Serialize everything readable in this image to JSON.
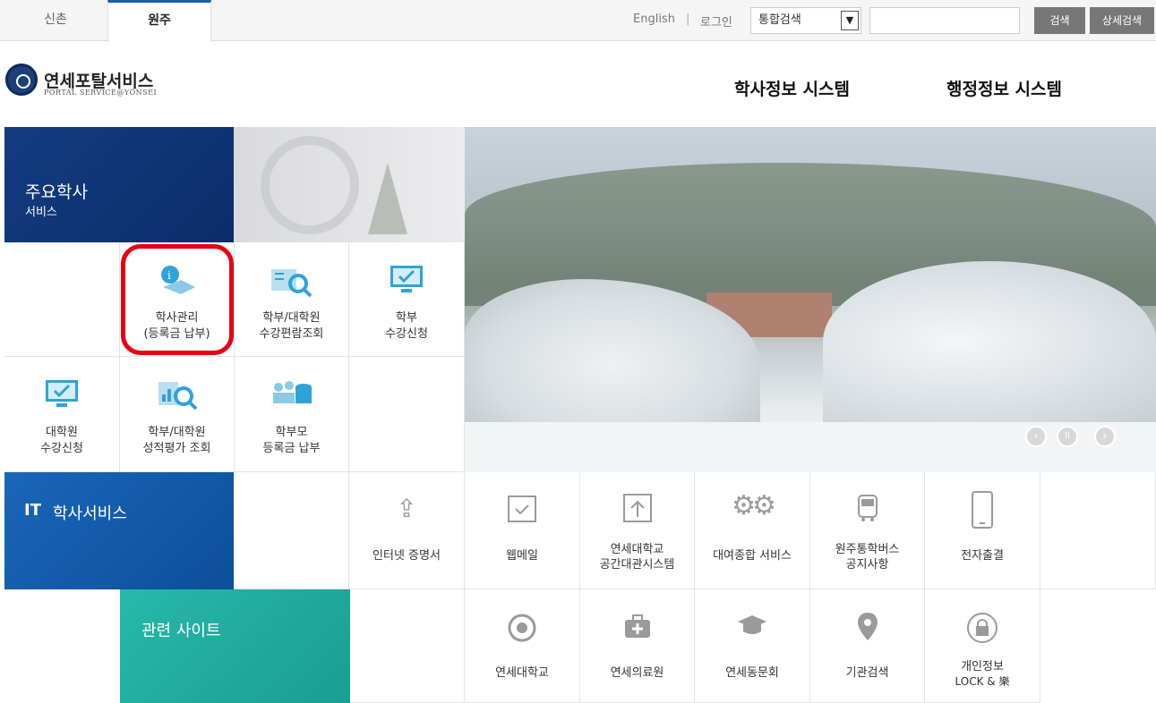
{
  "topbar": {
    "tabs": [
      {
        "label": "신촌"
      },
      {
        "label": "원주"
      }
    ],
    "english_link": "English",
    "separator": "|",
    "login_link": "로그인",
    "search_select": "통합검색",
    "search_button": "검색",
    "advanced_search_button": "상세검색"
  },
  "header": {
    "logo_title": "연세포탈서비스",
    "logo_subtitle": "PORTAL SERVICE@YONSEI",
    "nav": [
      {
        "label": "학사정보 시스템"
      },
      {
        "label": "행정정보 시스템"
      }
    ]
  },
  "academic": {
    "section_title": "주요학사",
    "section_subtitle": "서비스",
    "items": [
      {
        "line1": "학사관리",
        "line2": "(등록금 납부)",
        "icon": "academic-info-icon"
      },
      {
        "line1": "학부/대학원",
        "line2": "수강편람조회",
        "icon": "book-search-icon"
      },
      {
        "line1": "학부",
        "line2": "수강신청",
        "icon": "monitor-check-icon"
      },
      {
        "line1": "대학원",
        "line2": "수강신청",
        "icon": "monitor-check-icon"
      },
      {
        "line1": "학부/대학원",
        "line2": "성적평가 조회",
        "icon": "chart-search-icon"
      },
      {
        "line1": "학부모",
        "line2": "등록금 납부",
        "icon": "parents-coins-icon"
      }
    ]
  },
  "it_services": {
    "section_title": "학사서비스",
    "section_prefix": "IT",
    "items": [
      {
        "line1": "인터넷 증명서",
        "line2": "",
        "icon": "share-icon"
      },
      {
        "line1": "웹메일",
        "line2": "",
        "icon": "mail-check-icon"
      },
      {
        "line1": "연세대학교",
        "line2": "공간대관시스템",
        "icon": "upload-box-icon"
      },
      {
        "line1": "대여종합 서비스",
        "line2": "",
        "icon": "gears-icon"
      },
      {
        "line1": "원주통학버스",
        "line2": "공지사항",
        "icon": "bus-icon"
      },
      {
        "line1": "전자출결",
        "line2": "",
        "icon": "mobile-icon"
      }
    ]
  },
  "related": {
    "section_title": "관련 사이트",
    "items": [
      {
        "line1": "연세대학교",
        "line2": "",
        "icon": "emblem-icon"
      },
      {
        "line1": "연세의료원",
        "line2": "",
        "icon": "medical-kit-icon"
      },
      {
        "line1": "연세동문회",
        "line2": "",
        "icon": "graduation-cap-icon"
      },
      {
        "line1": "기관검색",
        "line2": "",
        "icon": "location-pin-icon"
      },
      {
        "line1": "개인정보",
        "line2": "LOCK & 樂",
        "icon": "lock-icon"
      }
    ]
  },
  "carousel": {
    "prev": "‹",
    "pause": "II",
    "next": "›"
  },
  "colors": {
    "highlight": "#e60012",
    "navy": "#123c82",
    "accent_blue": "#1a66b8",
    "teal": "#27b9a8",
    "icon_blue": "#2fa3d8"
  }
}
